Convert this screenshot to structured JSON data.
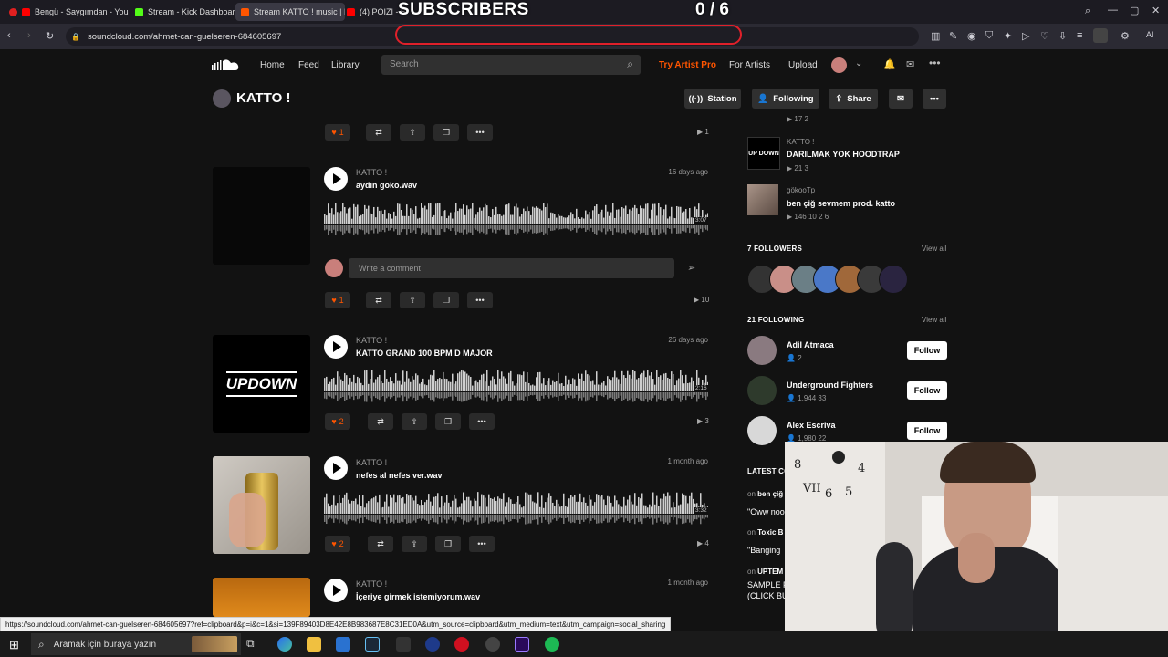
{
  "overlay": {
    "subscribers_label": "SUBSCRIBERS",
    "count": "0 / 6"
  },
  "browser": {
    "tabs": [
      {
        "label": "Bengü - Saygımdan - You"
      },
      {
        "label": "Stream - Kick Dashboard"
      },
      {
        "label": "Stream KATTO ! music | Li"
      },
      {
        "label": "(4) POIZI - S"
      }
    ],
    "url": "soundcloud.com/ahmet-can-guelseren-684605697"
  },
  "nav": {
    "home": "Home",
    "feed": "Feed",
    "library": "Library",
    "search_placeholder": "Search",
    "try_pro": "Try Artist Pro",
    "for_artists": "For Artists",
    "upload": "Upload"
  },
  "profile": {
    "name": "KATTO !",
    "station": "Station",
    "following": "Following",
    "share": "Share"
  },
  "tracks": [
    {
      "artist": "KATTO !",
      "title": "aydın goko.wav",
      "date": "16 days ago",
      "duration": "3:07",
      "likes": "1",
      "plays": "10",
      "comment_placeholder": "Write a comment"
    },
    {
      "artist": "KATTO !",
      "title": "KATTO GRAND 100 BPM D MAJOR",
      "date": "26 days ago",
      "duration": "2:16",
      "likes": "2",
      "plays": "3",
      "art_text": "UPDOWN"
    },
    {
      "artist": "KATTO !",
      "title": "nefes al nefes ver.wav",
      "date": "1 month ago",
      "duration": "3:32",
      "likes": "2",
      "plays": "4"
    },
    {
      "artist": "KATTO !",
      "title": "İçeriye girmek istemiyorum.wav",
      "date": "1 month ago"
    }
  ],
  "top_actions": {
    "likes": "1",
    "plays": "1"
  },
  "sidebar": {
    "top_stats": "17  2",
    "likes": [
      {
        "artist": "KATTO !",
        "title": "DARILMAK YOK HOODTRAP",
        "stats": "21  3"
      },
      {
        "artist": "gökooTp",
        "title": "ben çiğ sevmem prod. katto",
        "stats": "146  10  2  6"
      }
    ],
    "followers_title": "7 FOLLOWERS",
    "following_title": "21 FOLLOWING",
    "view_all": "View all",
    "following": [
      {
        "name": "Adil Atmaca",
        "stats": "2",
        "button": "Follow"
      },
      {
        "name": "Underground Fighters",
        "stats": "1,944  33",
        "button": "Follow"
      },
      {
        "name": "Alex Escriva",
        "stats": "1,980  22",
        "button": "Follow"
      }
    ],
    "latest_comments_title": "LATEST CO",
    "comments": [
      {
        "on": "on",
        "track": "ben çiğ",
        "text": "\"Oww noo"
      },
      {
        "on": "on",
        "track": "Toxic B",
        "text": "\"Banging"
      },
      {
        "on": "on",
        "track": "UPTEM",
        "text": "SAMPLE F\n(CLICK BU"
      }
    ]
  },
  "status_url": "https://soundcloud.com/ahmet-can-guelseren-684605697?ref=clipboard&p=i&c=1&si=139F89403D8E42E8B983687E8C31ED0A&utm_source=clipboard&utm_medium=text&utm_campaign=social_sharing",
  "taskbar": {
    "search_placeholder": "Aramak için buraya yazın"
  },
  "colors": {
    "accent": "#ff5500",
    "background": "#121212",
    "overlay_red": "#e0202a"
  }
}
